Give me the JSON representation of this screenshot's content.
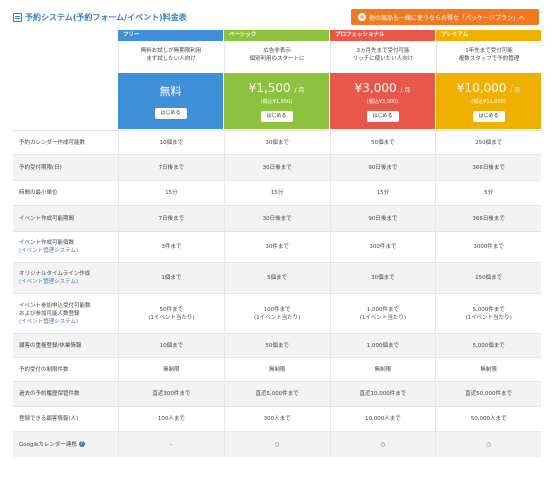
{
  "title": "予約システム(予約フォーム/イベント)料金表",
  "promo": {
    "label": "他の商品も一緒に使うならお得な「パッケージプラン」へ"
  },
  "plans": [
    {
      "name": "フリー",
      "desc1": "無料お試しが無期限利用",
      "desc2": "まず試したい人向け",
      "price": "無料",
      "unit": "",
      "tax": "",
      "button": "はじめる",
      "color": "#3f8fd9"
    },
    {
      "name": "ベーシック",
      "desc1": "広告非表示",
      "desc2": "個別利用のスタートに",
      "price": "¥1,500",
      "unit": "/ 月",
      "tax": "(税込¥1,650)",
      "button": "はじめる",
      "color": "#8cc23f"
    },
    {
      "name": "プロフェッショナル",
      "desc1": "3ヵ月先まで受付可能",
      "desc2": "リッチに使いたい人向け",
      "price": "¥3,000",
      "unit": "/ 月",
      "tax": "(税込¥3,300)",
      "button": "はじめる",
      "color": "#e8584a"
    },
    {
      "name": "プレミアム",
      "desc1": "1年先まで受付可能",
      "desc2": "複数スタッフで予約管理",
      "price": "¥10,000",
      "unit": "/ 月",
      "tax": "(税込¥11,000)",
      "button": "はじめる",
      "color": "#efb000"
    }
  ],
  "rows": [
    {
      "label": "予約カレンダー作成可能数",
      "link": "",
      "cells": [
        "10個まで",
        "30個まで",
        "50個まで",
        "250個まで"
      ]
    },
    {
      "label": "予約受付期限(日)",
      "link": "",
      "cells": [
        "7日後まで",
        "30日後まで",
        "90日後まで",
        "366日後まで"
      ]
    },
    {
      "label": "時間の最小単位",
      "link": "",
      "cells": [
        "15分",
        "15分",
        "15分",
        "5分"
      ]
    },
    {
      "label": "イベント作成可能期間",
      "link": "",
      "cells": [
        "7日後まで",
        "30日後まで",
        "90日後まで",
        "366日後まで"
      ]
    },
    {
      "label": "イベント作成可能個数",
      "link": "(イベント管理システム)",
      "cells": [
        "3件まで",
        "30件まで",
        "300件まで",
        "3000件まで"
      ]
    },
    {
      "label": "オリジナルタイムライン作成",
      "link": "(イベント管理システム)",
      "cells": [
        "1個まで",
        "5個まで",
        "30個まで",
        "150個まで"
      ]
    },
    {
      "label": "イベント参加申込受付可能数",
      "label2": "および参加可能人数登録",
      "link": "(イベント管理システム)",
      "cells": [
        "50件まで|(1イベント当たり)",
        "100件まで|(1イベント当たり)",
        "1,000件まで|(1イベント当たり)",
        "5,000件まで|(1イベント当たり)"
      ]
    },
    {
      "label": "顧客の重複登録/休業情報",
      "link": "",
      "cells": [
        "10個まで",
        "50個まで",
        "1,000個まで",
        "5,000個まで"
      ]
    },
    {
      "label": "予約受付の制限件数",
      "link": "",
      "cells": [
        "無制限",
        "無制限",
        "無制限",
        "無制限"
      ]
    },
    {
      "label": "過去の予約履歴保管件数",
      "link": "",
      "cells": [
        "直近300件まで",
        "直近5,000件まで",
        "直近10,000件まで",
        "直近50,000件まで"
      ]
    },
    {
      "label": "登録できる顧客情報(人)",
      "link": "",
      "cells": [
        "100人まで",
        "300人まで",
        "10,000人まで",
        "50,000人まで"
      ]
    },
    {
      "label": "Googleカレンダー連携",
      "link": "",
      "help": "?",
      "cells": [
        "-",
        "○",
        "○",
        "○"
      ]
    }
  ]
}
